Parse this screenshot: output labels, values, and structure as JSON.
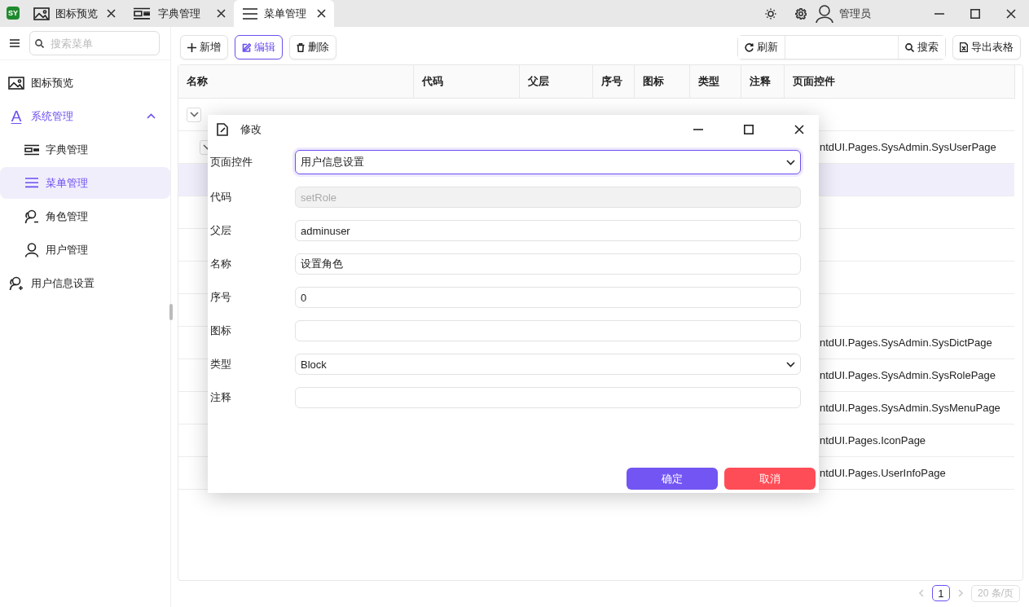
{
  "title_bar": {
    "logo": "SY",
    "tabs": [
      {
        "label": "图标预览",
        "kind": "image",
        "selected": false
      },
      {
        "label": "字典管理",
        "kind": "dict",
        "selected": false
      },
      {
        "label": "菜单管理",
        "kind": "menu",
        "selected": true
      }
    ],
    "user": "管理员"
  },
  "sidebar": {
    "search": {
      "placeholder": "搜索菜单"
    },
    "items": [
      {
        "label": "图标预览",
        "kind": "image",
        "selected": false
      },
      {
        "label": "系统管理",
        "kind": "glyph",
        "glyph": "A",
        "selected": false,
        "expanded": true,
        "children": [
          {
            "label": "字典管理",
            "kind": "dict",
            "selected": false
          },
          {
            "label": "菜单管理",
            "kind": "menu",
            "selected": true
          },
          {
            "label": "角色管理",
            "kind": "role",
            "selected": false
          },
          {
            "label": "用户管理",
            "kind": "user",
            "selected": false
          }
        ]
      },
      {
        "label": "用户信息设置",
        "kind": "user-add",
        "selected": false
      }
    ]
  },
  "toolbar": {
    "left": [
      {
        "label": "新增",
        "kind": "add",
        "focused": false
      },
      {
        "label": "编辑",
        "kind": "edit",
        "focused": true
      },
      {
        "label": "删除",
        "kind": "delete",
        "focused": false
      }
    ],
    "refresh": "刷新",
    "search": "搜索",
    "export": "导出表格"
  },
  "table": {
    "columns": [
      "名称",
      "代码",
      "父层",
      "序号",
      "图标",
      "类型",
      "注释",
      "页面控件"
    ],
    "rows": [
      {
        "expanded": true,
        "selected": false,
        "children": [
          {
            "page_control": "ntdUI.Pages.SysAdmin.SysUserPage",
            "expanded": true,
            "selected": false,
            "children": [
              {
                "selected": true
              },
              {
                "selected": false
              },
              {
                "selected": false
              },
              {
                "selected": false
              },
              {
                "selected": false
              }
            ]
          },
          {
            "page_control": "ntdUI.Pages.SysAdmin.SysDictPage",
            "selected": false
          },
          {
            "page_control": "ntdUI.Pages.SysAdmin.SysRolePage",
            "selected": false
          },
          {
            "page_control": "ntdUI.Pages.SysAdmin.SysMenuPage",
            "selected": false
          }
        ]
      },
      {
        "page_control": "ntdUI.Pages.IconPage",
        "selected": false
      },
      {
        "page_control": "ntdUI.Pages.UserInfoPage",
        "selected": false
      }
    ]
  },
  "pagination": {
    "pages": [
      {
        "label": "1",
        "selected": true
      }
    ],
    "page_size": "20 条/页"
  },
  "dialog": {
    "title": "修改",
    "fields": [
      {
        "label": "页面控件",
        "kind": "select",
        "value": "用户信息设置",
        "focused": true,
        "disabled": false
      },
      {
        "label": "代码",
        "kind": "text",
        "value": "setRole",
        "focused": false,
        "disabled": true
      },
      {
        "label": "父层",
        "kind": "text",
        "value": "adminuser",
        "focused": false,
        "disabled": false
      },
      {
        "label": "名称",
        "kind": "text",
        "value": "设置角色",
        "focused": false,
        "disabled": false
      },
      {
        "label": "序号",
        "kind": "text",
        "value": "0",
        "focused": false,
        "disabled": false
      },
      {
        "label": "图标",
        "kind": "text",
        "focused": false,
        "disabled": false
      },
      {
        "label": "类型",
        "kind": "select",
        "value": "Block",
        "focused": false,
        "disabled": false
      },
      {
        "label": "注释",
        "kind": "text",
        "focused": false,
        "disabled": false
      }
    ],
    "buttons": [
      {
        "label": "确定",
        "kind": "primary"
      },
      {
        "label": "取消",
        "kind": "danger"
      }
    ]
  }
}
